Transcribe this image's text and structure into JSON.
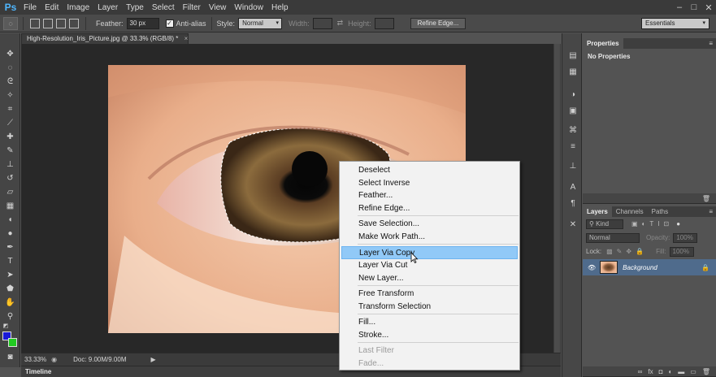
{
  "app": {
    "logo": "Ps",
    "menus": [
      "File",
      "Edit",
      "Image",
      "Layer",
      "Type",
      "Select",
      "Filter",
      "View",
      "Window",
      "Help"
    ]
  },
  "options_bar": {
    "feather_label": "Feather:",
    "feather_value": "30 px",
    "antialias_label": "Anti-alias",
    "style_label": "Style:",
    "style_value": "Normal",
    "width_label": "Width:",
    "height_label": "Height:",
    "refine_edge_button": "Refine Edge...",
    "workspace_value": "Essentials"
  },
  "document": {
    "tab_title": "High-Resolution_Iris_Picture.jpg @ 33.3% (RGB/8) *",
    "tab_close": "×"
  },
  "status": {
    "zoom": "33.33%",
    "doc_info": "Doc: 9.00M/9.00M"
  },
  "timeline_label": "Timeline",
  "properties_panel": {
    "tab": "Properties",
    "message": "No Properties"
  },
  "layers_panel": {
    "tabs": [
      "Layers",
      "Channels",
      "Paths"
    ],
    "kind_filter": "Kind",
    "blend_mode": "Normal",
    "opacity_label": "Opacity:",
    "opacity_value": "100%",
    "lock_label": "Lock:",
    "fill_label": "Fill:",
    "fill_value": "100%",
    "layer_name": "Background"
  },
  "context_menu": {
    "items": [
      {
        "label": "Deselect",
        "state": "normal"
      },
      {
        "label": "Select Inverse",
        "state": "normal"
      },
      {
        "label": "Feather...",
        "state": "normal"
      },
      {
        "label": "Refine Edge...",
        "state": "normal"
      },
      {
        "label": "Save Selection...",
        "state": "normal"
      },
      {
        "label": "Make Work Path...",
        "state": "normal"
      },
      {
        "label": "Layer Via Copy",
        "state": "highlighted"
      },
      {
        "label": "Layer Via Cut",
        "state": "normal"
      },
      {
        "label": "New Layer...",
        "state": "normal"
      },
      {
        "label": "Free Transform",
        "state": "normal"
      },
      {
        "label": "Transform Selection",
        "state": "normal"
      },
      {
        "label": "Fill...",
        "state": "normal"
      },
      {
        "label": "Stroke...",
        "state": "normal"
      },
      {
        "label": "Last Filter",
        "state": "disabled"
      },
      {
        "label": "Fade...",
        "state": "disabled"
      }
    ]
  },
  "colors": {
    "foreground": "#1a1ad6",
    "background": "#22cc22",
    "menu_highlight": "#91c9f7"
  }
}
